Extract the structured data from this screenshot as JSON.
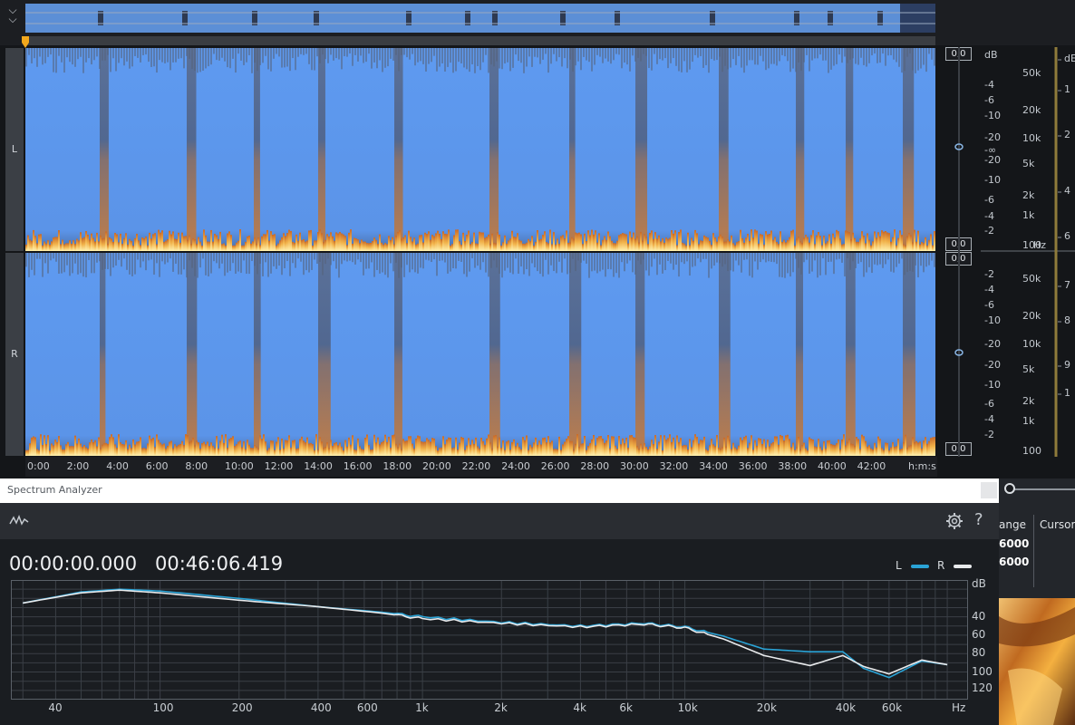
{
  "channels": {
    "left": "L",
    "right": "R"
  },
  "peak_values": [
    "0,0",
    "0,0",
    "0,0",
    "0,0"
  ],
  "db_scale_label": "dB",
  "db_scale_l": [
    "-4",
    "-6",
    "-10",
    "-20",
    "-∞",
    "-20",
    "-10",
    "-6",
    "-4",
    "-2"
  ],
  "db_scale_r": [
    "-2",
    "-4",
    "-6",
    "-10",
    "-20",
    "-20",
    "-10",
    "-6",
    "-4",
    "-2"
  ],
  "freq_scale_l": [
    "50k",
    "20k",
    "10k",
    "5k",
    "2k",
    "1k",
    "100"
  ],
  "freq_scale_r": [
    "50k",
    "20k",
    "10k",
    "5k",
    "2k",
    "1k",
    "100"
  ],
  "freq_unit": "Hz",
  "color_scale": [
    "dE",
    "1",
    "2",
    "4",
    "6",
    "7",
    "8",
    "9",
    "1"
  ],
  "time_ruler": [
    "0:00",
    "2:00",
    "4:00",
    "6:00",
    "8:00",
    "10:00",
    "12:00",
    "14:00",
    "16:00",
    "18:00",
    "20:00",
    "22:00",
    "24:00",
    "26:00",
    "28:00",
    "30:00",
    "32:00",
    "34:00",
    "36:00",
    "38:00",
    "40:00",
    "42:00",
    "h:m:s"
  ],
  "spectrum_analyzer": {
    "title": "Spectrum Analyzer",
    "start_time": "00:00:00.000",
    "end_time": "00:46:06.419",
    "legend_l": "L",
    "legend_r": "R",
    "colors": {
      "L": "#2aa3d6",
      "R": "#e8eaec"
    },
    "icons": [
      "waveform-icon",
      "gear-icon",
      "help-icon"
    ]
  },
  "side_panel": {
    "range_label": "ange",
    "cursor_label": "Cursor",
    "values": [
      "6000",
      "6000"
    ]
  },
  "chart_data": {
    "type": "line",
    "x_scale": "log",
    "x_ticks": [
      "40",
      "100",
      "200",
      "400",
      "600",
      "1k",
      "2k",
      "4k",
      "6k",
      "10k",
      "20k",
      "40k",
      "60k",
      "Hz"
    ],
    "y_ticks": [
      "dB",
      "40",
      "60",
      "80",
      "100",
      "120"
    ],
    "ylabel": "dB",
    "ylim": [
      0,
      130
    ],
    "series": [
      {
        "name": "L",
        "x": [
          30,
          50,
          70,
          100,
          200,
          400,
          700,
          1000,
          2000,
          4000,
          7000,
          10000,
          14000,
          20000,
          30000,
          40000,
          48000,
          60000,
          80000,
          100000
        ],
        "y": [
          25,
          13,
          10,
          12,
          20,
          29,
          35,
          40,
          46,
          50,
          47,
          51,
          61,
          75,
          78,
          78,
          96,
          106,
          88,
          92
        ]
      },
      {
        "name": "R",
        "x": [
          30,
          50,
          70,
          100,
          200,
          400,
          700,
          1000,
          2000,
          4000,
          7000,
          10000,
          14000,
          20000,
          30000,
          40000,
          48000,
          60000,
          80000,
          100000
        ],
        "y": [
          25,
          14,
          11,
          14,
          22,
          29,
          36,
          42,
          47,
          51,
          48,
          52,
          64,
          82,
          93,
          82,
          94,
          102,
          87,
          92
        ]
      }
    ]
  }
}
